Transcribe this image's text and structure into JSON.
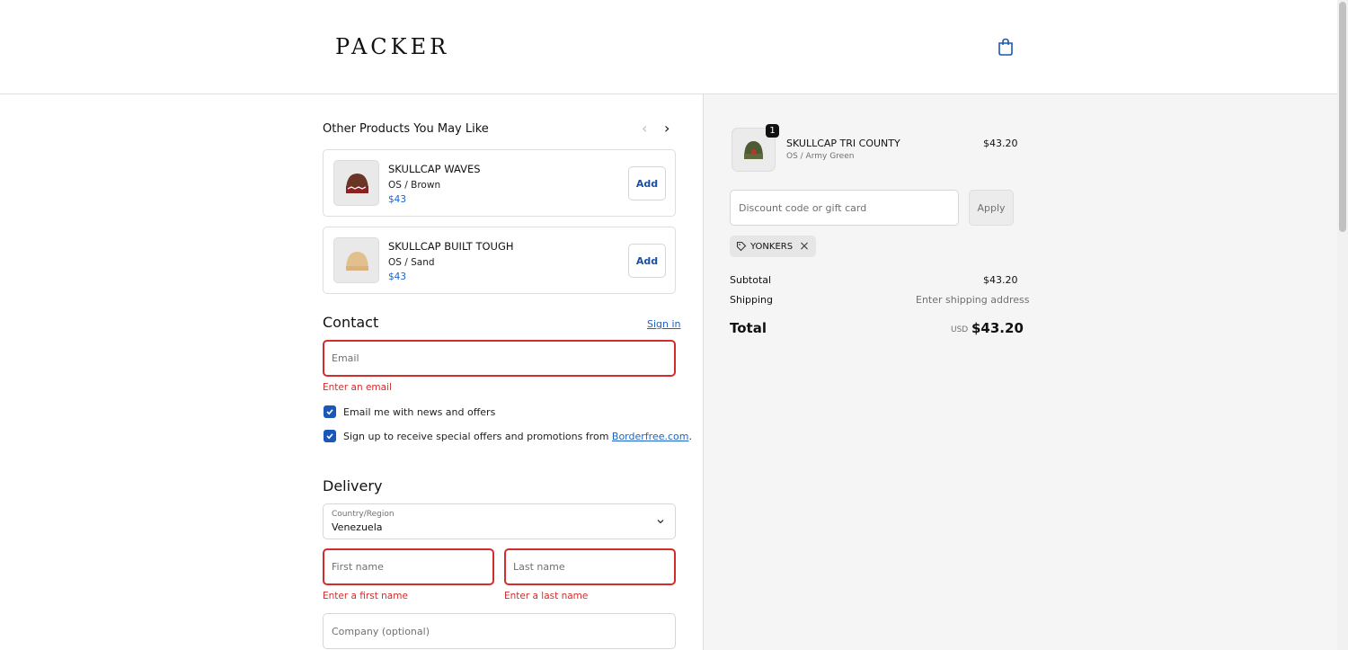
{
  "header": {
    "logo": "PACKER",
    "cart_icon": "shopping-bag-icon"
  },
  "upsell": {
    "title": "Other Products You May Like",
    "products": [
      {
        "name": "SKULLCAP WAVES",
        "variant": "OS / Brown",
        "price": "$43",
        "add_label": "Add"
      },
      {
        "name": "SKULLCAP BUILT TOUGH",
        "variant": "OS / Sand",
        "price": "$43",
        "add_label": "Add"
      }
    ]
  },
  "contact": {
    "title": "Contact",
    "sign_in": "Sign in",
    "email_placeholder": "Email",
    "email_error": "Enter an email",
    "newsletter_label": "Email me with news and offers",
    "borderfree_prefix": "Sign up to receive special offers and promotions from ",
    "borderfree_link": "Borderfree.com",
    "borderfree_suffix": "."
  },
  "delivery": {
    "title": "Delivery",
    "country_label": "Country/Region",
    "country_value": "Venezuela",
    "first_name_placeholder": "First name",
    "first_name_error": "Enter a first name",
    "last_name_placeholder": "Last name",
    "last_name_error": "Enter a last name",
    "company_placeholder": "Company (optional)"
  },
  "summary": {
    "item": {
      "name": "SKULLCAP TRI COUNTY",
      "variant": "OS / Army Green",
      "price": "$43.20",
      "quantity": "1"
    },
    "discount_placeholder": "Discount code or gift card",
    "apply_label": "Apply",
    "applied_code": "YONKERS",
    "subtotal_label": "Subtotal",
    "subtotal_value": "$43.20",
    "shipping_label": "Shipping",
    "shipping_value": "Enter shipping address",
    "total_label": "Total",
    "currency": "USD",
    "total_value": "$43.20"
  },
  "colors": {
    "accent": "#1a57b8",
    "error": "#d22d2d",
    "summary_bg": "#f5f5f5"
  }
}
